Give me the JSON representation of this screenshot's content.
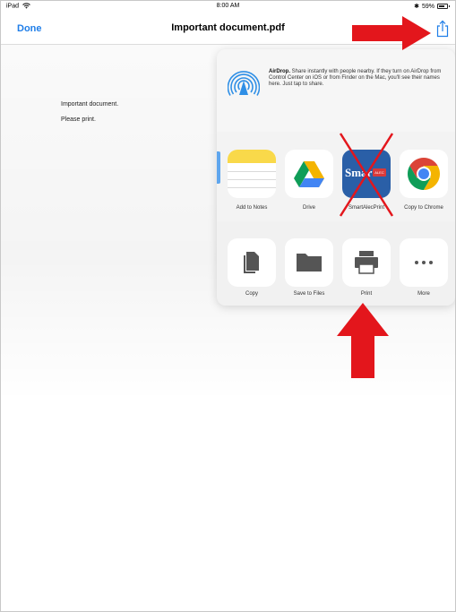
{
  "status_bar": {
    "device": "iPad",
    "time": "8:00 AM",
    "battery": "59%"
  },
  "nav": {
    "done_label": "Done",
    "title": "Important document.pdf"
  },
  "document": {
    "lines": [
      "Important document.",
      "Please print."
    ]
  },
  "airdrop": {
    "title": "AirDrop.",
    "text": "Share instantly with people nearby. If they turn on AirDrop from Control Center on iOS or from Finder on the Mac, you'll see their names here. Just tap to share."
  },
  "apps_row": [
    {
      "label": "Add to Notes",
      "icon": "notes-icon"
    },
    {
      "label": "Drive",
      "icon": "google-drive-icon"
    },
    {
      "label": "SmartAlecPrint",
      "icon": "smartalecprint-icon",
      "icon_text": "Smart",
      "badge": "ALEC"
    },
    {
      "label": "Copy to Chrome",
      "icon": "chrome-icon"
    }
  ],
  "actions_row": [
    {
      "label": "Copy",
      "icon": "copy-icon"
    },
    {
      "label": "Save to Files",
      "icon": "folder-icon"
    },
    {
      "label": "Print",
      "icon": "printer-icon"
    },
    {
      "label": "More",
      "icon": "more-icon"
    }
  ],
  "colors": {
    "accent": "#1f7ee8",
    "arrow": "#e3161c",
    "notes_yellow": "#f9d94a"
  }
}
